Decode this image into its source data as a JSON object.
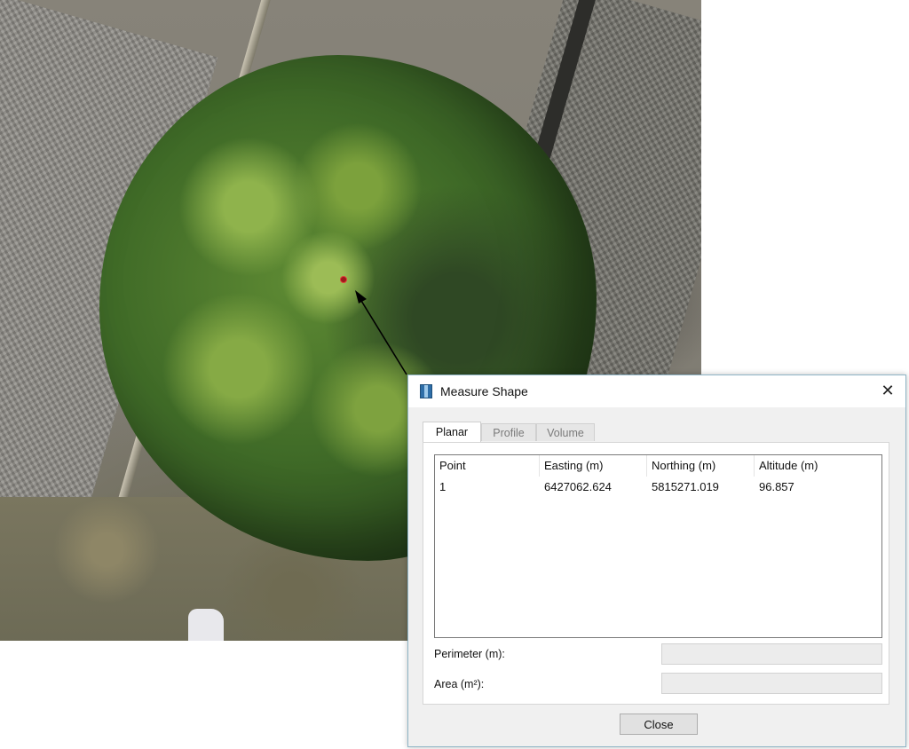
{
  "dialog": {
    "title": "Measure Shape",
    "icon": "ruler-icon",
    "close_glyph": "✕",
    "tabs": [
      {
        "label": "Planar",
        "active": true
      },
      {
        "label": "Profile",
        "active": false
      },
      {
        "label": "Volume",
        "active": false
      }
    ],
    "table": {
      "columns": [
        "Point",
        "Easting (m)",
        "Northing (m)",
        "Altitude (m)"
      ],
      "rows": [
        [
          "1",
          "6427062.624",
          "5815271.019",
          "96.857"
        ]
      ]
    },
    "perimeter_label": "Perimeter (m):",
    "perimeter_value": "",
    "area_label": "Area (m²):",
    "area_value": "",
    "close_button_label": "Close"
  },
  "colors": {
    "dialog_border": "#8fb5c6",
    "measure_point": "#e23a3a",
    "tree_canopy": "#4c7a2c"
  }
}
